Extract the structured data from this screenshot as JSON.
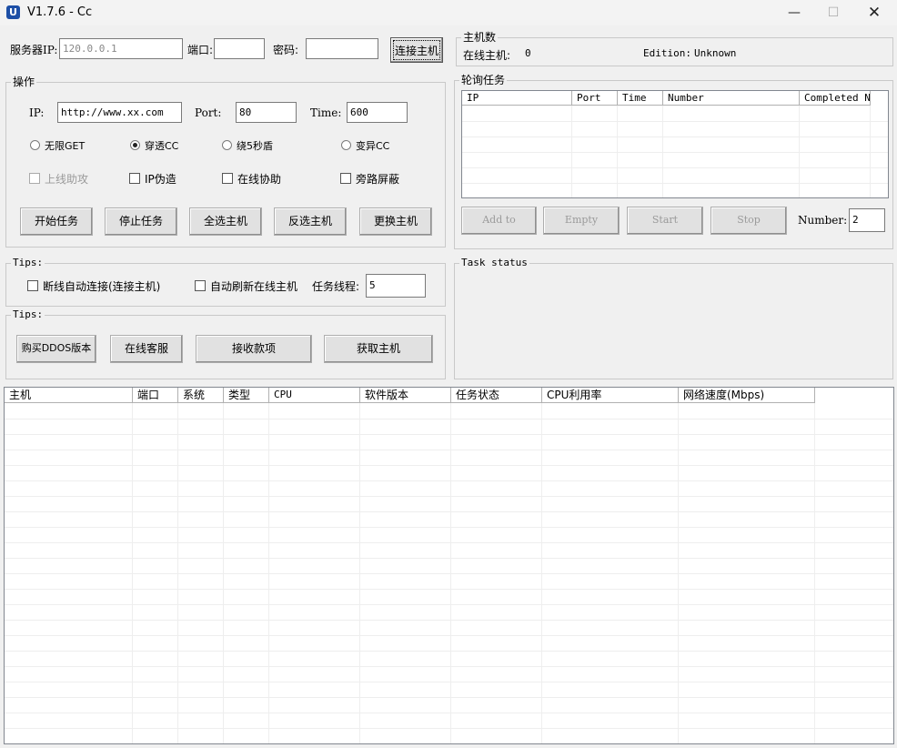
{
  "window": {
    "title": "V1.7.6 - Cc",
    "icon": "app-logo-icon"
  },
  "connection": {
    "server_ip_label": "服务器IP:",
    "server_ip_value": "120.0.0.1",
    "port_label": "端口:",
    "port_value": "",
    "password_label": "密码:",
    "password_value": "",
    "connect_button": "连接主机"
  },
  "host_count": {
    "title": "主机数",
    "online_label": "在线主机:",
    "online_value": "0",
    "edition_label": "Edition:",
    "edition_value": "Unknown"
  },
  "operation": {
    "title": "操作",
    "ip_label": "IP:",
    "ip_value": "http://www.xx.com",
    "port_label": "Port:",
    "port_value": "80",
    "time_label": "Time:",
    "time_value": "600",
    "radios": [
      {
        "label": "无限GET",
        "selected": false
      },
      {
        "label": "穿透CC",
        "selected": true
      },
      {
        "label": "绕5秒盾",
        "selected": false
      },
      {
        "label": "变异CC",
        "selected": false
      }
    ],
    "checks": [
      {
        "label": "上线助攻",
        "checked": false,
        "disabled": true
      },
      {
        "label": "IP伪造",
        "checked": false,
        "disabled": false
      },
      {
        "label": "在线协助",
        "checked": false,
        "disabled": false
      },
      {
        "label": "旁路屏蔽",
        "checked": false,
        "disabled": false
      }
    ],
    "buttons": [
      "开始任务",
      "停止任务",
      "全选主机",
      "反选主机",
      "更换主机"
    ]
  },
  "polling": {
    "title": "轮询任务",
    "columns": [
      "IP",
      "Port",
      "Time",
      "Number",
      "Completed N"
    ],
    "buttons": [
      "Add to",
      "Empty",
      "Start",
      "Stop"
    ],
    "number_label": "Number:",
    "number_value": "2"
  },
  "tips1": {
    "title": "Tips:",
    "auto_reconnect": "断线自动连接(连接主机)",
    "auto_refresh": "自动刷新在线主机",
    "threads_label": "任务线程:",
    "threads_value": "5"
  },
  "tips2": {
    "title": "Tips:",
    "buttons": [
      "购买DDOS版本",
      "在线客服",
      "接收款项",
      "获取主机"
    ]
  },
  "task_status": {
    "title": "Task status"
  },
  "hosts_table": {
    "columns": [
      "主机",
      "端口",
      "系统",
      "类型",
      "CPU",
      "软件版本",
      "任务状态",
      "CPU利用率",
      "网络速度(Mbps)"
    ]
  }
}
